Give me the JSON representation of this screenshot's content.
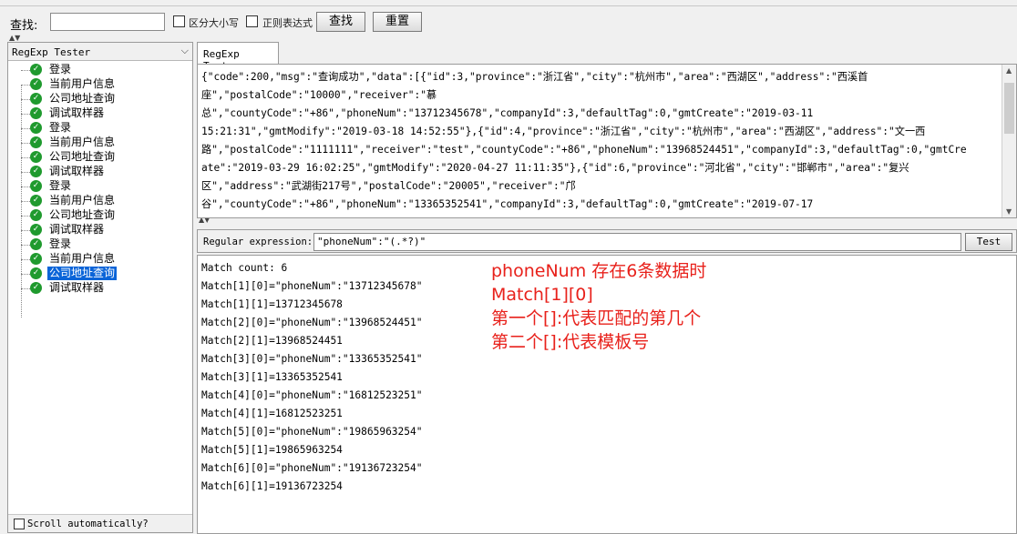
{
  "search": {
    "label": "查找:",
    "value": "",
    "case_label": "区分大小写",
    "regex_label": "正则表达式",
    "find_button": "查找",
    "reset_button": "重置"
  },
  "left": {
    "dropdown_value": "RegExp Tester",
    "tree_items": [
      {
        "label": "登录"
      },
      {
        "label": "当前用户信息"
      },
      {
        "label": "公司地址查询"
      },
      {
        "label": "调试取样器"
      },
      {
        "label": "登录"
      },
      {
        "label": "当前用户信息"
      },
      {
        "label": "公司地址查询"
      },
      {
        "label": "调试取样器"
      },
      {
        "label": "登录"
      },
      {
        "label": "当前用户信息"
      },
      {
        "label": "公司地址查询"
      },
      {
        "label": "调试取样器"
      },
      {
        "label": "登录"
      },
      {
        "label": "当前用户信息"
      },
      {
        "label": "公司地址查询"
      },
      {
        "label": "调试取样器"
      }
    ],
    "selected_index": 14,
    "scroll_label": "Scroll automatically?"
  },
  "right": {
    "tab_label": "RegExp Tester",
    "response_lines": [
      "{\"code\":200,\"msg\":\"查询成功\",\"data\":[{\"id\":3,\"province\":\"浙江省\",\"city\":\"杭州市\",\"area\":\"西湖区\",\"address\":\"西溪首",
      "座\",\"postalCode\":\"10000\",\"receiver\":\"慕",
      "总\",\"countyCode\":\"+86\",\"phoneNum\":\"13712345678\",\"companyId\":3,\"defaultTag\":0,\"gmtCreate\":\"2019-03-11",
      "15:21:31\",\"gmtModify\":\"2019-03-18 14:52:55\"},{\"id\":4,\"province\":\"浙江省\",\"city\":\"杭州市\",\"area\":\"西湖区\",\"address\":\"文一西",
      "路\",\"postalCode\":\"1111111\",\"receiver\":\"test\",\"countyCode\":\"+86\",\"phoneNum\":\"13968524451\",\"companyId\":3,\"defaultTag\":0,\"gmtCre",
      "ate\":\"2019-03-29 16:02:25\",\"gmtModify\":\"2020-04-27 11:11:35\"},{\"id\":6,\"province\":\"河北省\",\"city\":\"邯郸市\",\"area\":\"复兴",
      "区\",\"address\":\"武湖街217号\",\"postalCode\":\"20005\",\"receiver\":\"邝",
      "谷\",\"countyCode\":\"+86\",\"phoneNum\":\"13365352541\",\"companyId\":3,\"defaultTag\":0,\"gmtCreate\":\"2019-07-17"
    ],
    "regex_label": "Regular expression:",
    "regex_value": "\"phoneNum\":\"(.*?)\"",
    "test_button": "Test",
    "results": [
      "Match count: 6",
      "Match[1][0]=\"phoneNum\":\"13712345678\"",
      "Match[1][1]=13712345678",
      "Match[2][0]=\"phoneNum\":\"13968524451\"",
      "Match[2][1]=13968524451",
      "Match[3][0]=\"phoneNum\":\"13365352541\"",
      "Match[3][1]=13365352541",
      "Match[4][0]=\"phoneNum\":\"16812523251\"",
      "Match[4][1]=16812523251",
      "Match[5][0]=\"phoneNum\":\"19865963254\"",
      "Match[5][1]=19865963254",
      "Match[6][0]=\"phoneNum\":\"19136723254\"",
      "Match[6][1]=19136723254"
    ],
    "annotation_lines": [
      "phoneNum 存在6条数据时",
      "Match[1][0]",
      "第一个[]:代表匹配的第几个",
      "第二个[]:代表模板号"
    ]
  },
  "colors": {
    "selection": "#0a64d8",
    "annotation": "#e8211b",
    "ok_icon": "#1f9a2e"
  }
}
